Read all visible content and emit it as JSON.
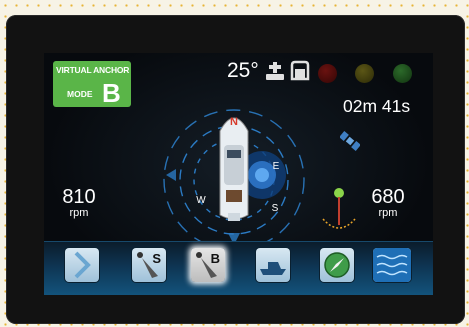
{
  "mode_badge": {
    "line1": "VIRTUAL ANCHOR",
    "line2": "MODE",
    "letter": "B",
    "color": "#5ab548"
  },
  "status": {
    "heading": "25°",
    "timer": "02m 41s",
    "lamps": [
      {
        "name": "red",
        "color": "#6a1210"
      },
      {
        "name": "yellow",
        "color": "#5b5616"
      },
      {
        "name": "green",
        "color": "#2c6a2a"
      }
    ]
  },
  "compass": {
    "north": "N",
    "east": "E",
    "south": "S",
    "west": "W"
  },
  "engines": {
    "port": {
      "value": "810",
      "unit": "rpm"
    },
    "starboard": {
      "value": "680",
      "unit": "rpm"
    }
  },
  "toolbar": {
    "buttons": [
      {
        "name": "forward-chevron",
        "icon": "chevron-right-icon",
        "letter": ""
      },
      {
        "name": "anchor-s",
        "icon": "anchor-pin-icon",
        "letter": "S"
      },
      {
        "name": "anchor-b",
        "icon": "anchor-pin-icon",
        "letter": "B",
        "selected": true
      },
      {
        "name": "boat-profile",
        "icon": "boat-icon",
        "letter": ""
      },
      {
        "name": "compass",
        "icon": "compass-icon",
        "letter": ""
      },
      {
        "name": "waves",
        "icon": "waves-icon",
        "letter": ""
      }
    ]
  }
}
